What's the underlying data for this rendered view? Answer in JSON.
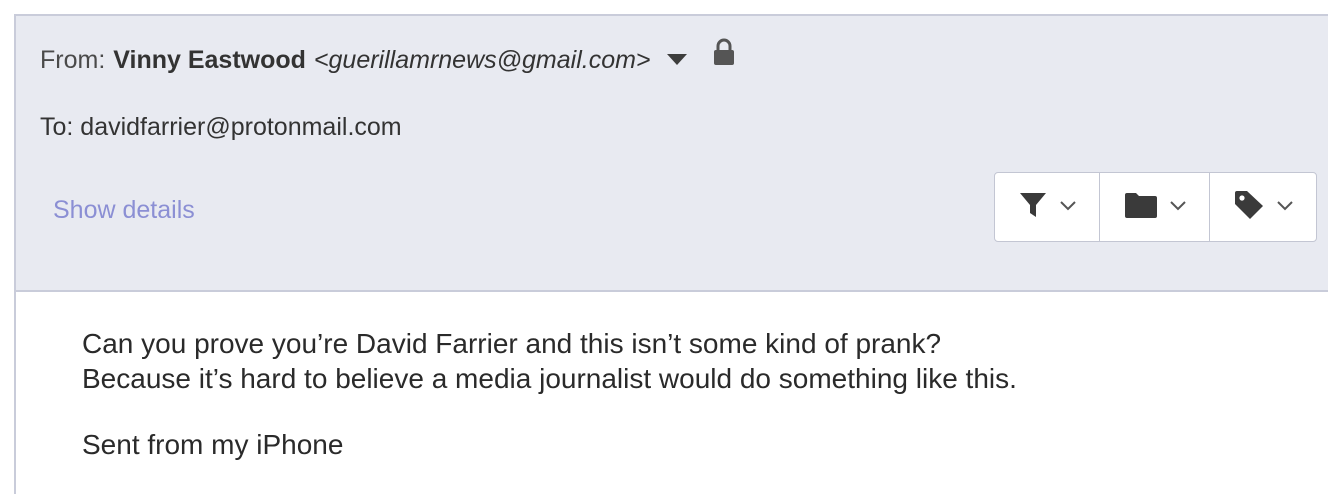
{
  "header": {
    "from_label": "From:",
    "from_name": "Vinny Eastwood",
    "from_email": "<guerillamrnews@gmail.com>",
    "to_text": "To: davidfarrier@protonmail.com",
    "show_details": "Show details",
    "icons": [
      "caret-down-icon",
      "lock-icon"
    ]
  },
  "toolbar": {
    "buttons": [
      {
        "icon": "filter-icon",
        "dropdown": "chevron-down-icon"
      },
      {
        "icon": "folder-icon",
        "dropdown": "chevron-down-icon"
      },
      {
        "icon": "tag-icon",
        "dropdown": "chevron-down-icon"
      }
    ]
  },
  "message": {
    "line1": "Can you prove you’re David Farrier and this isn’t some kind of prank?",
    "line2": "Because it’s hard to believe a media journalist would do something like this.",
    "signature": "Sent from my iPhone"
  },
  "colors": {
    "header_bg": "#e8eaf1",
    "link": "#8b8fd4",
    "border": "#c9ccda"
  }
}
